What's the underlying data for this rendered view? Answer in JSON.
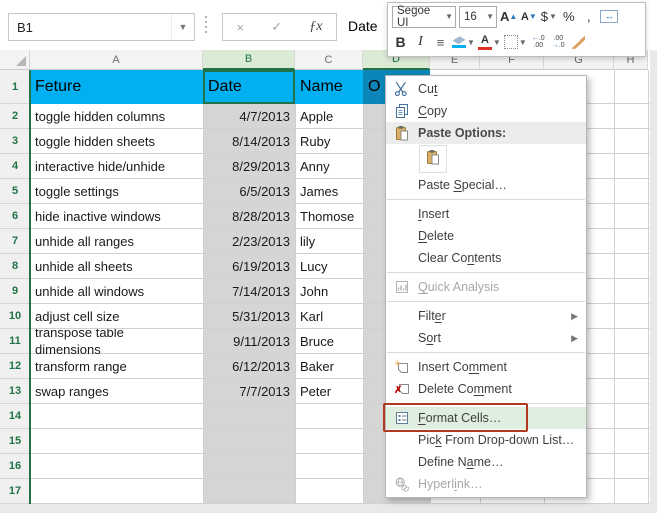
{
  "formula_bar": {
    "name_box_value": "B1",
    "cancel_icon": "×",
    "enter_icon": "✓",
    "function_icon": "ƒx",
    "value": "Date"
  },
  "mini_toolbar": {
    "font_name": "Segoe UI",
    "font_size": "16",
    "grow_font_label": "A",
    "shrink_font_label": "A",
    "currency_label": "$",
    "percent_label": "%",
    "comma_label": ",",
    "bold_label": "B",
    "italic_label": "I",
    "align_icon": "≡",
    "merge_icon": "↔",
    "font_color_label": "A",
    "increase_decimal_top": "←.0",
    "increase_decimal_bottom": ".00",
    "decrease_decimal_top": ".00",
    "decrease_decimal_bottom": "→.0"
  },
  "sheet": {
    "columns": [
      {
        "label": "A",
        "selected": false
      },
      {
        "label": "B",
        "selected": true
      },
      {
        "label": "C",
        "selected": false
      },
      {
        "label": "D",
        "selected": true
      },
      {
        "label": "E",
        "selected": false
      },
      {
        "label": "F",
        "selected": false
      },
      {
        "label": "G",
        "selected": false
      },
      {
        "label": "H",
        "selected": false
      }
    ],
    "row_numbers": [
      1,
      2,
      3,
      4,
      5,
      6,
      7,
      8,
      9,
      10,
      11,
      12,
      13,
      14,
      15,
      16,
      17
    ],
    "header_row": {
      "A": "Feture",
      "B": "Date",
      "C": "Name",
      "D": "O"
    },
    "rows": [
      {
        "n": 2,
        "feature": "toggle hidden columns",
        "date": "4/7/2013",
        "name": "Apple"
      },
      {
        "n": 3,
        "feature": "toggle hidden sheets",
        "date": "8/14/2013",
        "name": "Ruby"
      },
      {
        "n": 4,
        "feature": "interactive hide/unhide",
        "date": "8/29/2013",
        "name": "Anny"
      },
      {
        "n": 5,
        "feature": "toggle settings",
        "date": "6/5/2013",
        "name": "James"
      },
      {
        "n": 6,
        "feature": "hide inactive windows",
        "date": "8/28/2013",
        "name": "Thomose"
      },
      {
        "n": 7,
        "feature": "unhide all ranges",
        "date": "2/23/2013",
        "name": "lily"
      },
      {
        "n": 8,
        "feature": "unhide all sheets",
        "date": "6/19/2013",
        "name": "Lucy"
      },
      {
        "n": 9,
        "feature": "unhide all windows",
        "date": "7/14/2013",
        "name": "John"
      },
      {
        "n": 10,
        "feature": "adjust cell size",
        "date": "5/31/2013",
        "name": "Karl"
      },
      {
        "n": 11,
        "feature": "transpose table dimensions",
        "date": "9/11/2013",
        "name": "Bruce",
        "wrap": true
      },
      {
        "n": 12,
        "feature": "transform range",
        "date": "6/12/2013",
        "name": "Baker"
      },
      {
        "n": 13,
        "feature": "swap ranges",
        "date": "7/7/2013",
        "name": "Peter"
      }
    ]
  },
  "context_menu": {
    "items": [
      {
        "label": "Cut",
        "u": 2,
        "icon": "cut-icon"
      },
      {
        "label": "Copy",
        "u": 0,
        "icon": "copy-icon"
      },
      {
        "label": "Paste Options:",
        "icon": "paste-icon",
        "band": true
      },
      {
        "type": "paste_row",
        "icon": "paste-icon"
      },
      {
        "label": "Paste Special…",
        "u": 6
      },
      {
        "type": "separator"
      },
      {
        "label": "Insert",
        "u": 0
      },
      {
        "label": "Delete",
        "u": 0
      },
      {
        "label": "Clear Contents",
        "u": 8
      },
      {
        "type": "separator"
      },
      {
        "label": "Quick Analysis",
        "u": 0,
        "icon": "quick-analysis-icon",
        "disabled": true
      },
      {
        "type": "separator"
      },
      {
        "label": "Filter",
        "u": 4,
        "submenu": true
      },
      {
        "label": "Sort",
        "u": 1,
        "submenu": true
      },
      {
        "type": "separator"
      },
      {
        "label": "Insert Comment",
        "u": 9,
        "icon": "insert-comment-icon"
      },
      {
        "label": "Delete Comment",
        "u": 9,
        "icon": "delete-comment-icon"
      },
      {
        "type": "separator"
      },
      {
        "label": "Format Cells…",
        "u": 0,
        "icon": "format-cells-icon",
        "highlighted": true,
        "annotated": true
      },
      {
        "label": "Pick From Drop-down List…",
        "u": 3
      },
      {
        "label": "Define Name…",
        "u": 8
      },
      {
        "label": "Hyperlink…",
        "u": 6,
        "icon": "hyperlink-icon",
        "disabled": true
      }
    ]
  },
  "colors": {
    "header_fill": "#00B0F0",
    "selected_header_cell_fill": "#0C85B8",
    "selection_gray": "#D5D5D5",
    "excel_green": "#217346",
    "selected_col_header_fill": "#DCEBD5",
    "menu_highlight_green": "#DFEEDF",
    "annotation_red": "#B03A21",
    "accent_blue": "#2B77BC",
    "font_color_red": "#E03020",
    "fill_color_cyan": "#00B0F0"
  }
}
